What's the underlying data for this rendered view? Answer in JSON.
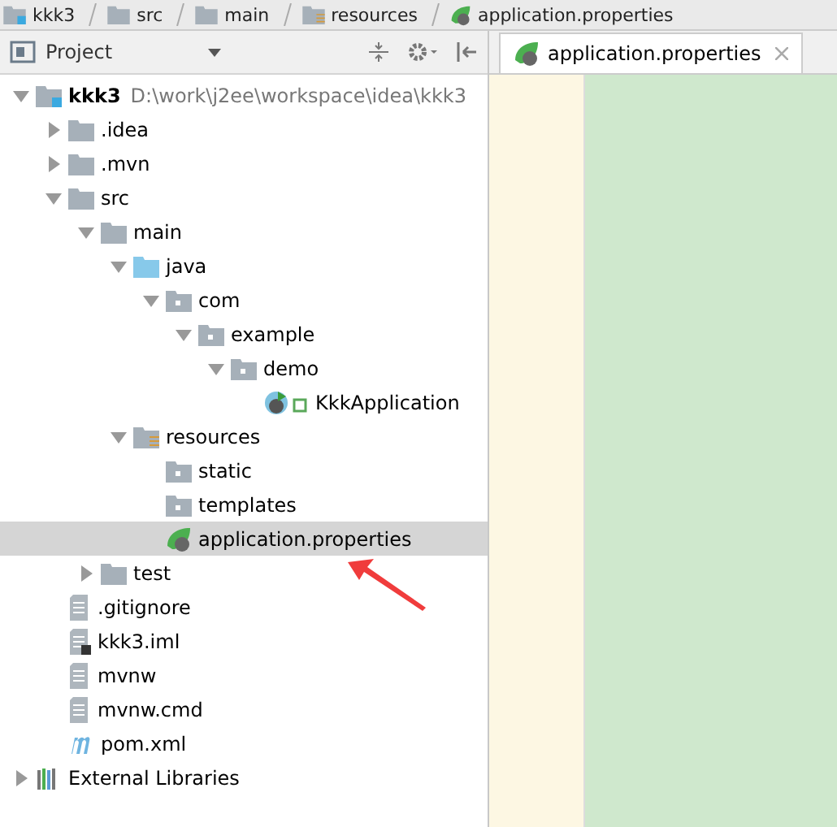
{
  "breadcrumbs": [
    {
      "label": "kkk3",
      "kind": "module"
    },
    {
      "label": "src",
      "kind": "folder"
    },
    {
      "label": "main",
      "kind": "folder"
    },
    {
      "label": "resources",
      "kind": "resources"
    },
    {
      "label": "application.properties",
      "kind": "spring"
    }
  ],
  "project_panel": {
    "title": "Project"
  },
  "tree": [
    {
      "name": "kkk3",
      "path": "D:\\work\\j2ee\\workspace\\idea\\kkk3",
      "kind": "module",
      "expanded": true,
      "selected": false,
      "children": [
        {
          "name": ".idea",
          "kind": "folder",
          "expanded": false,
          "selected": false
        },
        {
          "name": ".mvn",
          "kind": "folder",
          "expanded": false,
          "selected": false
        },
        {
          "name": "src",
          "kind": "folder",
          "expanded": true,
          "selected": false,
          "children": [
            {
              "name": "main",
              "kind": "folder",
              "expanded": true,
              "selected": false,
              "children": [
                {
                  "name": "java",
                  "kind": "source",
                  "expanded": true,
                  "selected": false,
                  "children": [
                    {
                      "name": "com",
                      "kind": "package",
                      "expanded": true,
                      "selected": false,
                      "children": [
                        {
                          "name": "example",
                          "kind": "package",
                          "expanded": true,
                          "selected": false,
                          "children": [
                            {
                              "name": "demo",
                              "kind": "package",
                              "expanded": true,
                              "selected": false,
                              "children": [
                                {
                                  "name": "KkkApplication",
                                  "kind": "spring-class",
                                  "selected": false
                                }
                              ]
                            }
                          ]
                        }
                      ]
                    }
                  ]
                },
                {
                  "name": "resources",
                  "kind": "resources",
                  "expanded": true,
                  "selected": false,
                  "children": [
                    {
                      "name": "static",
                      "kind": "package",
                      "selected": false
                    },
                    {
                      "name": "templates",
                      "kind": "package",
                      "selected": false
                    },
                    {
                      "name": "application.properties",
                      "kind": "spring",
                      "selected": true
                    }
                  ]
                }
              ]
            },
            {
              "name": "test",
              "kind": "folder",
              "expanded": false,
              "selected": false
            }
          ]
        },
        {
          "name": ".gitignore",
          "kind": "file",
          "selected": false
        },
        {
          "name": "kkk3.iml",
          "kind": "iml",
          "selected": false
        },
        {
          "name": "mvnw",
          "kind": "file",
          "selected": false
        },
        {
          "name": "mvnw.cmd",
          "kind": "file",
          "selected": false
        },
        {
          "name": "pom.xml",
          "kind": "maven",
          "selected": false
        }
      ]
    },
    {
      "name": "External Libraries",
      "kind": "libraries",
      "expanded": false,
      "selected": false
    }
  ],
  "editor_tabs": [
    {
      "label": "application.properties",
      "kind": "spring",
      "selected": true
    }
  ]
}
